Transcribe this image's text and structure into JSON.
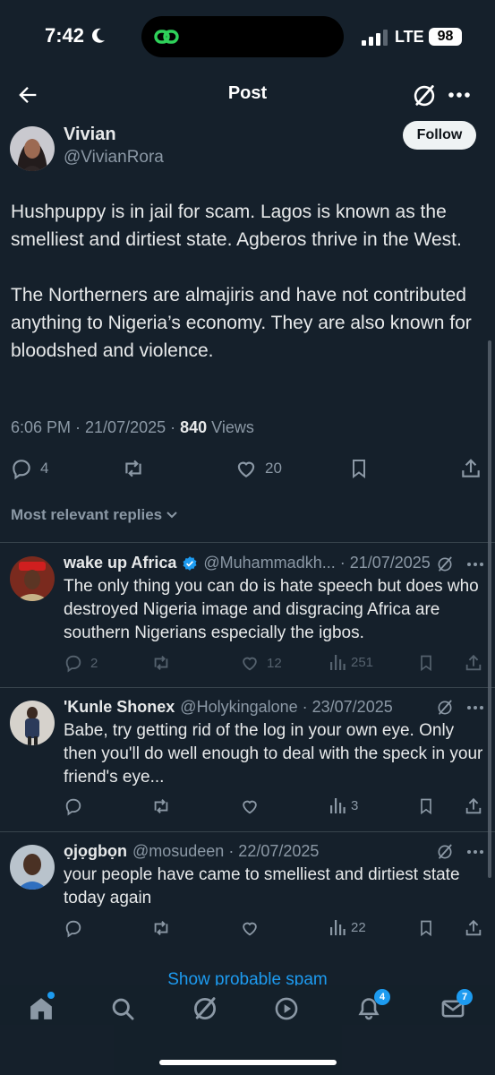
{
  "status": {
    "time": "7:42",
    "network": "LTE",
    "battery": "98"
  },
  "header": {
    "title": "Post"
  },
  "post": {
    "author_name": "Vivian",
    "author_handle": "@VivianRora",
    "follow_label": "Follow",
    "text_p1": "Hushpuppy is in jail for scam. Lagos is known as the smelliest and dirtiest state. Agberos thrive in the West.",
    "text_p2": "The Northerners are almajiris and have not contributed anything to Nigeria’s economy. They are also known for bloodshed and violence.",
    "timestamp": "6:06 PM · 21/07/2025 · ",
    "views_count": "840",
    "views_label": " Views",
    "replies": "4",
    "likes": "20"
  },
  "replies_sort_label": "Most relevant replies",
  "replies": [
    {
      "name": "wake up Africa",
      "handle_date": "@Muhammadkh... · 21/07/2025",
      "text": "The only thing you can do is hate speech but does who destroyed Nigeria image and disgracing Africa are southern Nigerians especially the igbos.",
      "replies": "2",
      "likes": "12",
      "views": "251"
    },
    {
      "name": "'Kunle Shonex",
      "handle_date": "@Holykingalone · 23/07/2025",
      "text": "Babe, try getting rid of the log in your own eye. Only then you'll do well enough to deal with the speck in your friend's eye...",
      "views": "3"
    },
    {
      "name": "ọjọgbọn",
      "handle_date": "@mosudeen · 22/07/2025",
      "text": "your people have came to smelliest and dirtiest state today again",
      "views": "22"
    }
  ],
  "show_spam_label": "Show probable spam",
  "tabbar": {
    "notifications_badge": "4",
    "messages_badge": "7"
  },
  "colors": {
    "background": "#15202b",
    "accent": "#1d9bf0",
    "text": "#e7e9ea",
    "muted": "#8b98a5"
  }
}
